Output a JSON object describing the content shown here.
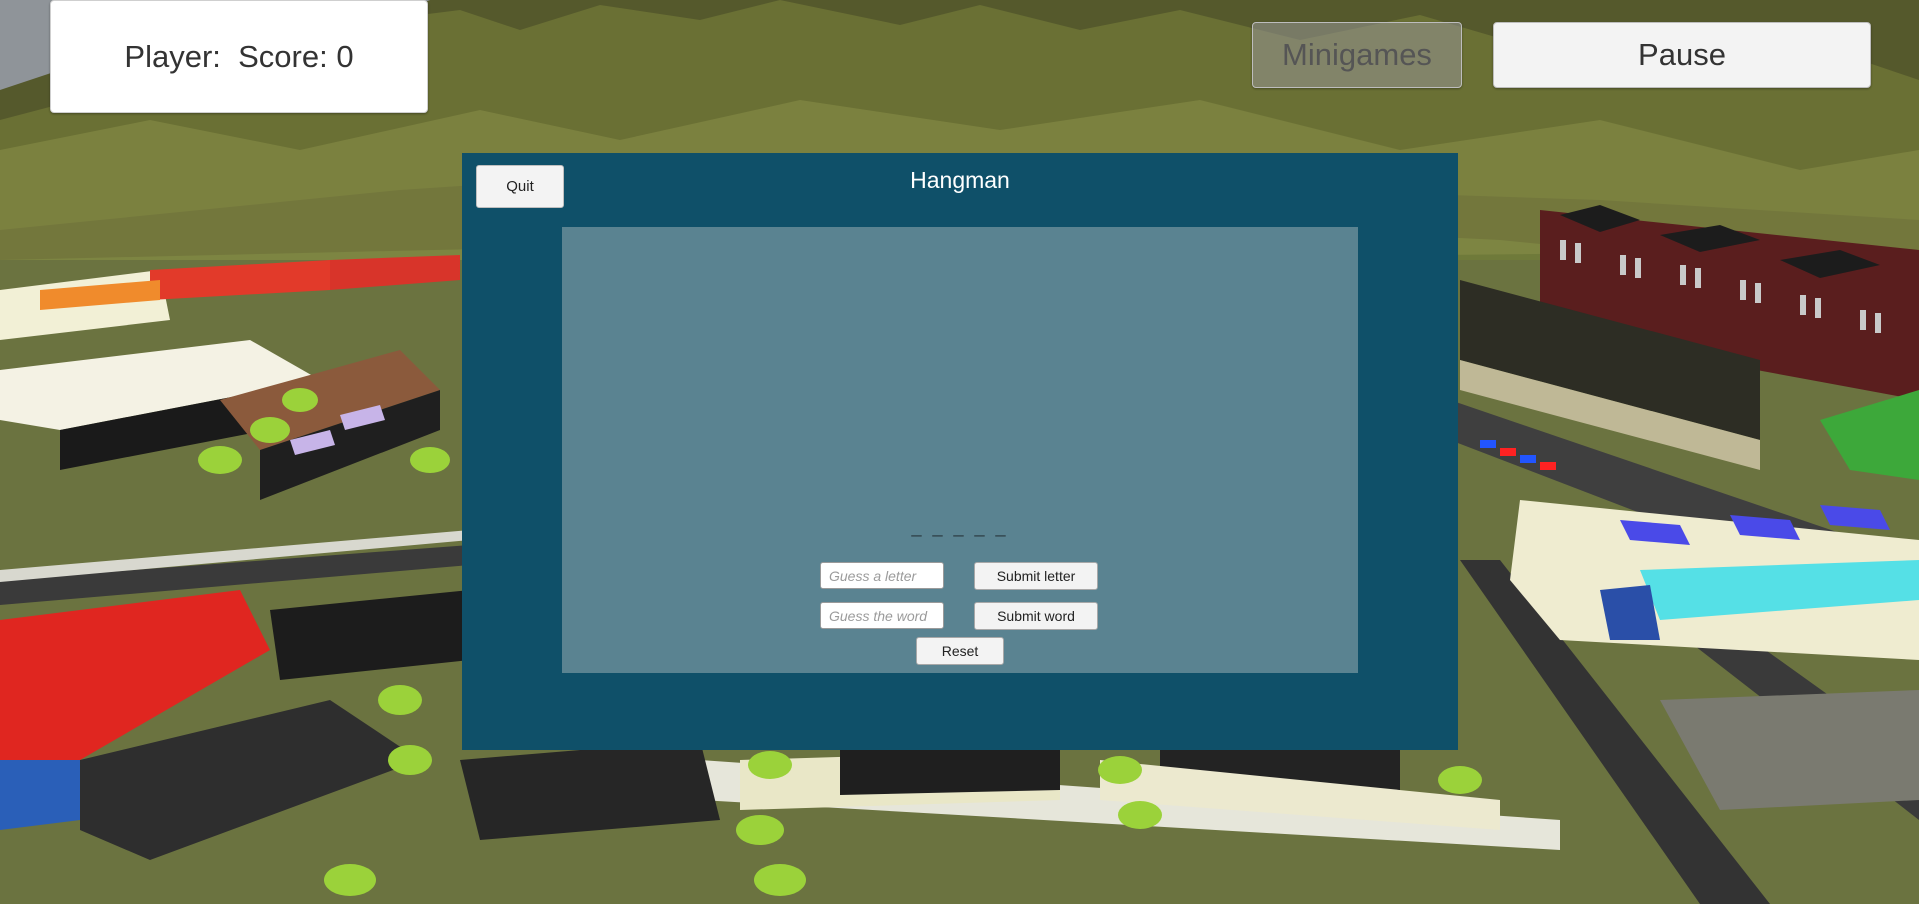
{
  "hud": {
    "player_label": "Player:",
    "score_text": "Score: 0",
    "minigames_label": "Minigames",
    "pause_label": "Pause"
  },
  "hangman": {
    "title": "Hangman",
    "quit_label": "Quit",
    "word_blanks": "_ _ _ _ _",
    "letter_placeholder": "Guess a letter",
    "word_placeholder": "Guess the word",
    "submit_letter_label": "Submit letter",
    "submit_word_label": "Submit word",
    "reset_label": "Reset"
  },
  "colors": {
    "window_bg": "#0f5069",
    "game_area_bg": "#5a8391",
    "button_bg": "#f3f3f3"
  }
}
